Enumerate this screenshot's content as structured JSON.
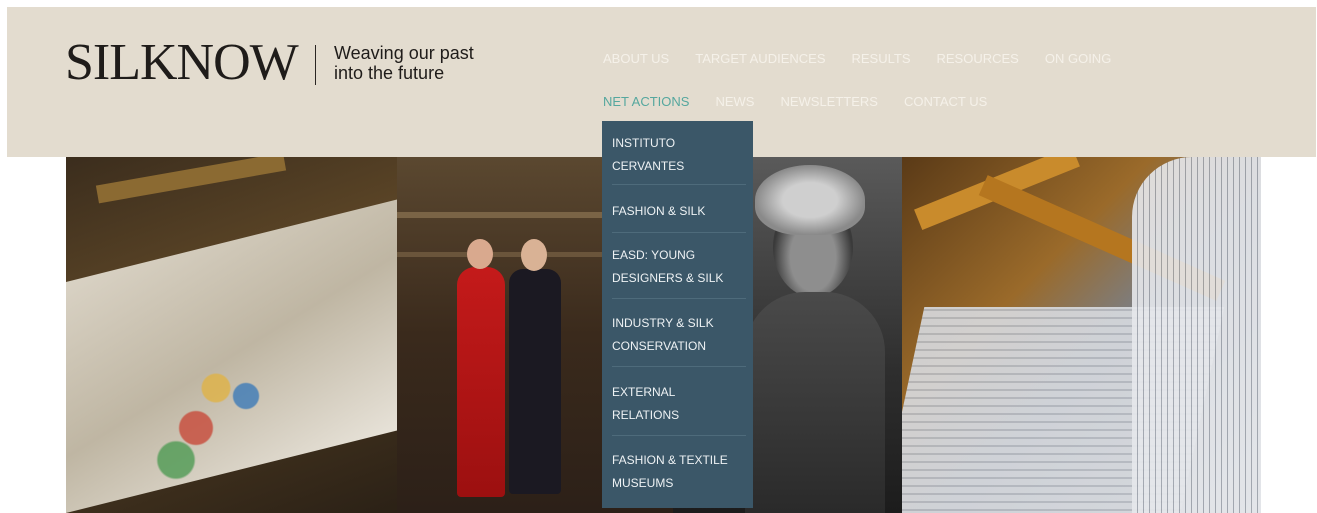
{
  "logo": {
    "brand": "SILKNOW",
    "tagline_line1": "Weaving our past",
    "tagline_line2": "into the future"
  },
  "nav": {
    "row1": [
      "ABOUT US",
      "TARGET AUDIENCES",
      "RESULTS",
      "RESOURCES",
      "ON GOING"
    ],
    "row2": [
      "NET ACTIONS",
      "NEWS",
      "NEWSLETTERS",
      "CONTACT US"
    ]
  },
  "dropdown": [
    {
      "line1": "INSTITUTO",
      "line2": "CERVANTES"
    },
    {
      "line1": "FASHION & SILK",
      "line2": ""
    },
    {
      "line1": "EASD: YOUNG",
      "line2": "DESIGNERS & SILK"
    },
    {
      "line1": "INDUSTRY & SILK",
      "line2": "CONSERVATION"
    },
    {
      "line1": "EXTERNAL",
      "line2": "RELATIONS"
    },
    {
      "line1": "FASHION & TEXTILE",
      "line2": "MUSEUMS"
    }
  ],
  "colors": {
    "header_bg": "#e3dccf",
    "dropdown_bg": "#3b5768",
    "accent": "#4aa39a"
  }
}
